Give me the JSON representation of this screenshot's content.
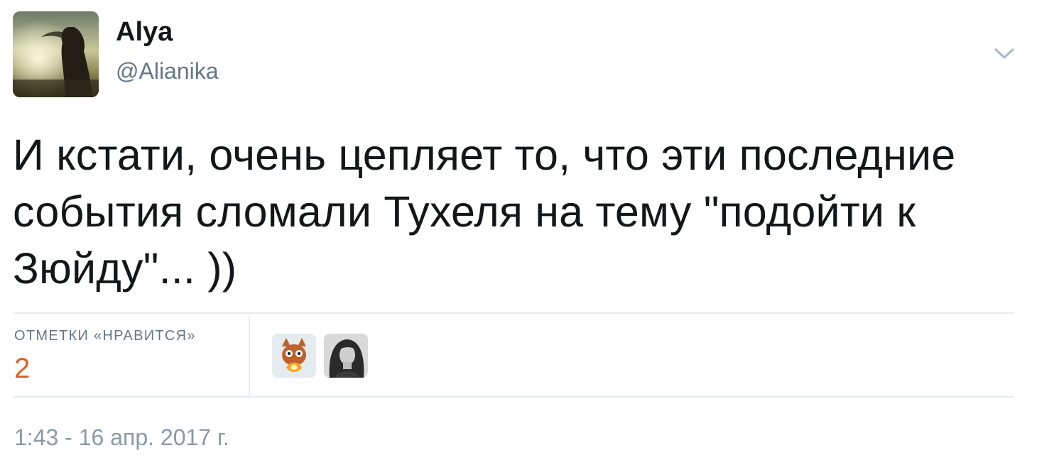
{
  "user": {
    "name": "Alya",
    "handle": "@Alianika"
  },
  "tweet": {
    "text": "И кстати, очень цепляет то, что эти последние события сломали Тухеля на тему \"подойти к Зюйду\"... ))"
  },
  "stats": {
    "likes_label": "ОТМЕТКИ «НРАВИТСЯ»",
    "likes_count": "2"
  },
  "timestamp": "1:43 - 16 апр. 2017 г.",
  "icons": {
    "menu": "chevron-down-icon"
  },
  "colors": {
    "likes_count": "#e0602b",
    "secondary_text": "#657786",
    "divider": "#e6ecf0"
  }
}
